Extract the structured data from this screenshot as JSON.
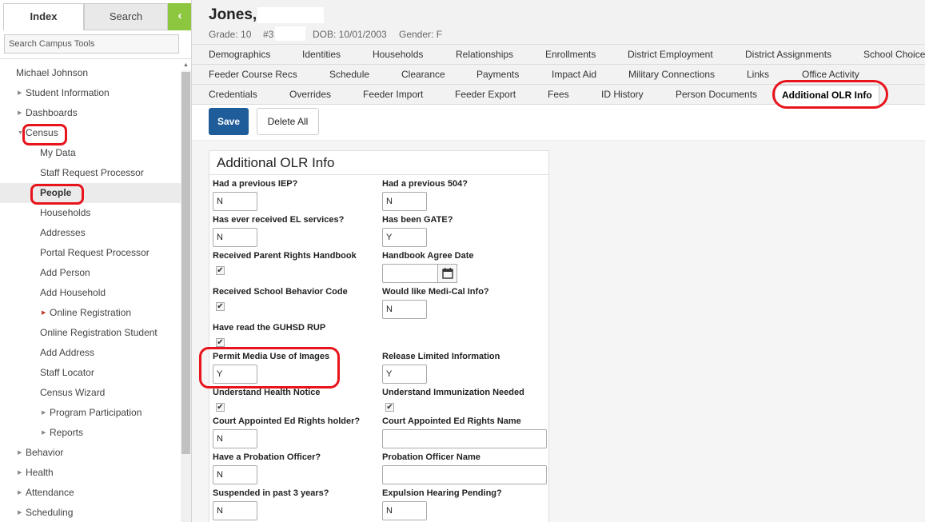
{
  "sidebar": {
    "tabs": {
      "index": "Index",
      "search": "Search",
      "collapse_glyph": "‹"
    },
    "search_placeholder": "Search Campus Tools",
    "user": "Michael Johnson",
    "items": [
      {
        "label": "Student Information",
        "arrow": "▶"
      },
      {
        "label": "Dashboards",
        "arrow": "▶"
      },
      {
        "label": "Census",
        "arrow": "▼"
      },
      {
        "label": "My Data"
      },
      {
        "label": "Staff Request Processor"
      },
      {
        "label": "People"
      },
      {
        "label": "Households"
      },
      {
        "label": "Addresses"
      },
      {
        "label": "Portal Request Processor"
      },
      {
        "label": "Add Person"
      },
      {
        "label": "Add Household"
      },
      {
        "label": "Online Registration",
        "arrow": "▶"
      },
      {
        "label": "Online Registration Student"
      },
      {
        "label": "Add Address"
      },
      {
        "label": "Staff Locator"
      },
      {
        "label": "Census Wizard"
      },
      {
        "label": "Program Participation",
        "arrow": "▶"
      },
      {
        "label": "Reports",
        "arrow": "▶"
      },
      {
        "label": "Behavior",
        "arrow": "▶"
      },
      {
        "label": "Health",
        "arrow": "▶"
      },
      {
        "label": "Attendance",
        "arrow": "▶"
      },
      {
        "label": "Scheduling",
        "arrow": "▶"
      }
    ]
  },
  "header": {
    "name": "Jones,",
    "grade": "Grade: 10",
    "id": "#3",
    "dob": "DOB: 10/01/2003",
    "gender": "Gender: F"
  },
  "tabs": {
    "row1": [
      "Demographics",
      "Identities",
      "Households",
      "Relationships",
      "Enrollments",
      "District Employment",
      "District Assignments",
      "School Choice"
    ],
    "row2": [
      "Feeder Course Recs",
      "Schedule",
      "Clearance",
      "Payments",
      "Impact Aid",
      "Military Connections",
      "Links",
      "Office Activity"
    ],
    "row3": [
      "Credentials",
      "Overrides",
      "Feeder Import",
      "Feeder Export",
      "Fees",
      "ID History",
      "Person Documents",
      "Additional OLR Info"
    ]
  },
  "toolbar": {
    "save": "Save",
    "delete_all": "Delete All"
  },
  "panel": {
    "title": "Additional OLR Info",
    "fields": {
      "prev_iep": {
        "label": "Had a previous IEP?",
        "value": "N"
      },
      "prev_504": {
        "label": "Had a previous 504?",
        "value": "N"
      },
      "el_services": {
        "label": "Has ever received EL services?",
        "value": "N"
      },
      "gate": {
        "label": "Has been GATE?",
        "value": "Y"
      },
      "parent_rights": {
        "label": "Received Parent Rights Handbook",
        "checked": "✔"
      },
      "handbook_date": {
        "label": "Handbook Agree Date",
        "value": ""
      },
      "behavior_code": {
        "label": "Received School Behavior Code",
        "checked": "✔"
      },
      "medi_cal": {
        "label": "Would like Medi-Cal Info?",
        "value": "N"
      },
      "guhsd_rup": {
        "label": "Have read the GUHSD RUP",
        "checked": "✔"
      },
      "media_images": {
        "label": "Permit Media Use of Images",
        "value": "Y"
      },
      "release_limited": {
        "label": "Release Limited Information",
        "value": "Y"
      },
      "health_notice": {
        "label": "Understand Health Notice",
        "checked": "✔"
      },
      "immunization": {
        "label": "Understand Immunization Needed",
        "checked": "✔"
      },
      "ed_rights_holder": {
        "label": "Court Appointed Ed Rights holder?",
        "value": "N"
      },
      "ed_rights_name": {
        "label": "Court Appointed Ed Rights Name",
        "value": ""
      },
      "probation_officer": {
        "label": "Have a Probation Officer?",
        "value": "N"
      },
      "probation_name": {
        "label": "Probation Officer Name",
        "value": ""
      },
      "suspended": {
        "label": "Suspended in past 3 years?",
        "value": "N"
      },
      "expulsion": {
        "label": "Expulsion Hearing Pending?",
        "value": "N"
      }
    }
  },
  "colors": {
    "save_button": "#1f5c9a",
    "collapse_button": "#8dc63f",
    "annotation": "#e8141c"
  }
}
